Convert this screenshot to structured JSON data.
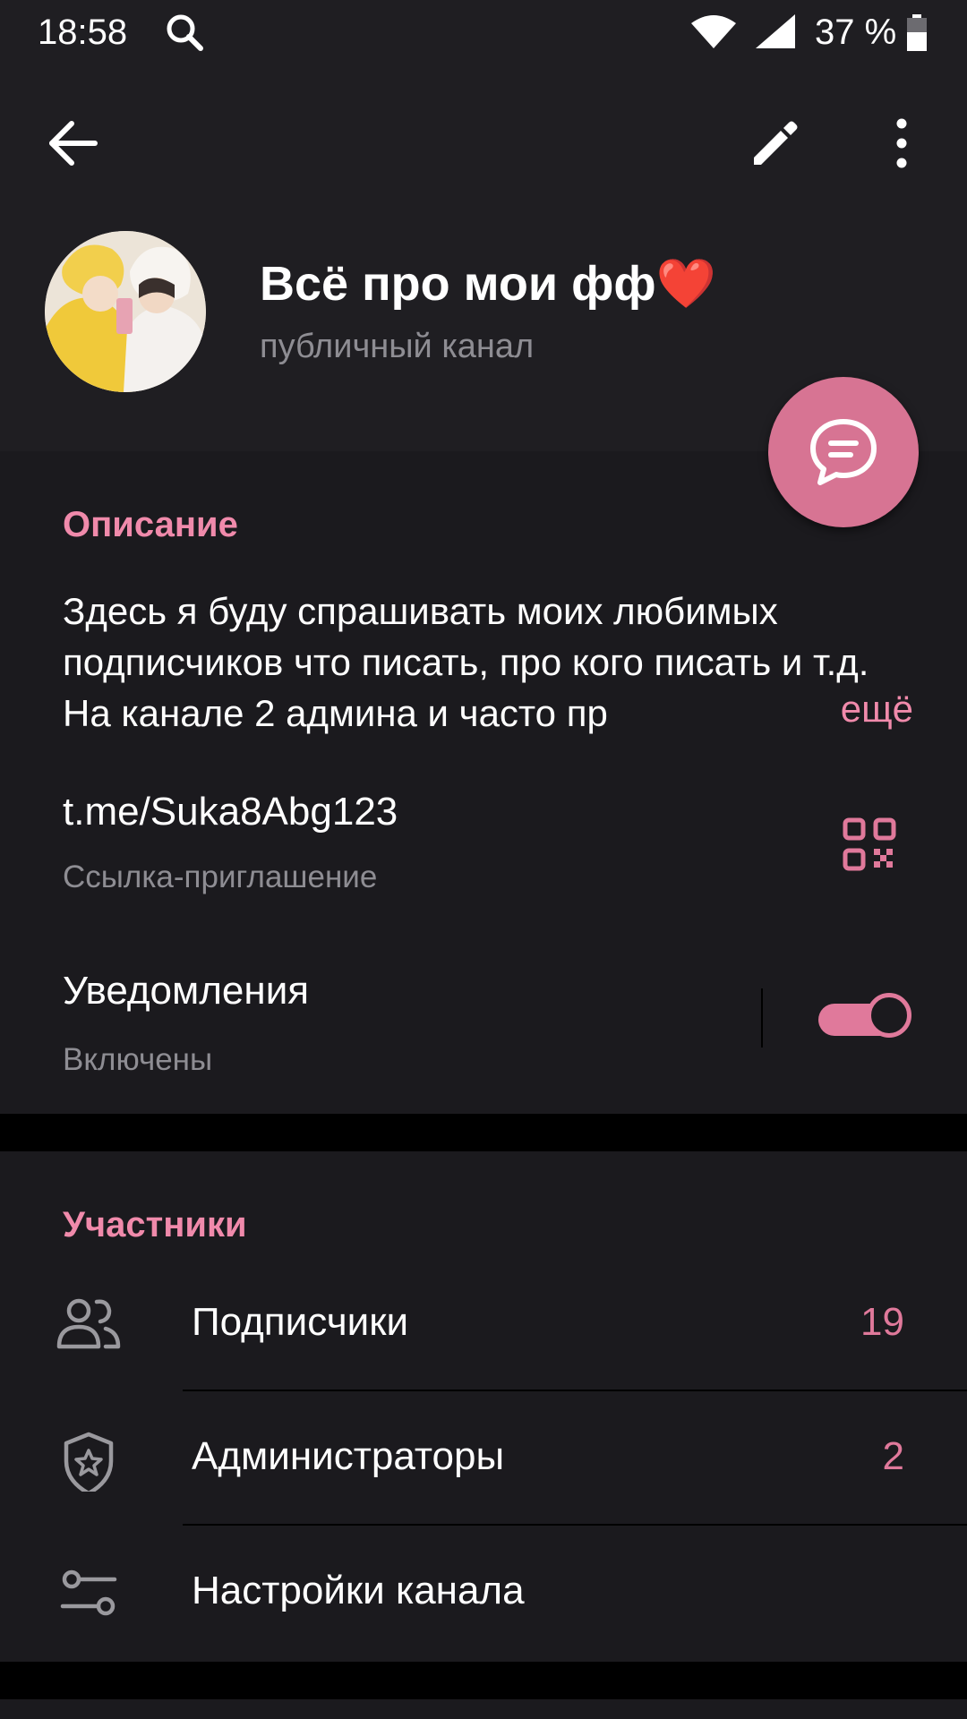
{
  "status_bar": {
    "time": "18:58",
    "battery_percent": "37 %",
    "icons": [
      "search-icon",
      "wifi-icon",
      "signal-icon",
      "battery-icon"
    ]
  },
  "toolbar": {
    "icons": [
      "back-arrow-icon",
      "edit-pencil-icon",
      "more-vert-icon"
    ]
  },
  "channel": {
    "title": "Всё про мои фф❤️",
    "subtitle": "публичный канал"
  },
  "description": {
    "section_title": "Описание",
    "text": "Здесь я буду спрашивать моих любимых подписчиков что писать, про кого писать и т.д. На канале 2 админа и часто пр",
    "more_label": "ещё"
  },
  "invite_link": {
    "url": "t.me/Suka8Abg123",
    "label": "Ссылка-приглашение"
  },
  "notifications": {
    "label": "Уведомления",
    "status": "Включены",
    "enabled": true
  },
  "participants": {
    "section_title": "Участники",
    "rows": [
      {
        "label": "Подписчики",
        "count": "19",
        "icon": "people-icon"
      },
      {
        "label": "Администраторы",
        "count": "2",
        "icon": "shield-star-icon"
      },
      {
        "label": "Настройки канала",
        "count": "",
        "icon": "settings-sliders-icon"
      }
    ]
  },
  "colors": {
    "accent": "#e0799b",
    "header_bg": "#1f1e22",
    "section_bg": "#1b1a1e",
    "fab_bg": "#d77493"
  }
}
